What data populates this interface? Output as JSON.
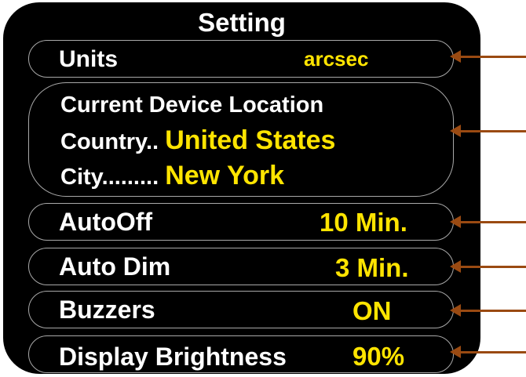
{
  "screen": {
    "title": "Setting"
  },
  "rows": {
    "units": {
      "label": "Units",
      "value": "arcsec"
    },
    "location": {
      "heading": "Current Device Location",
      "country_label": "Country..",
      "country_value": "United States",
      "city_label": "City.........",
      "city_value": "New York"
    },
    "autooff": {
      "label": "AutoOff",
      "value": "10 Min."
    },
    "autodim": {
      "label": "Auto Dim",
      "value": "3 Min."
    },
    "buzzers": {
      "label": "Buzzers",
      "value": "ON"
    },
    "brightness": {
      "label": "Display Brightness",
      "value": "90%"
    }
  },
  "colors": {
    "background": "#000000",
    "label_text": "#ffffff",
    "value_text": "#ffe400",
    "row_border": "#a9a9a9",
    "callout_arrow": "#9a4a12"
  }
}
